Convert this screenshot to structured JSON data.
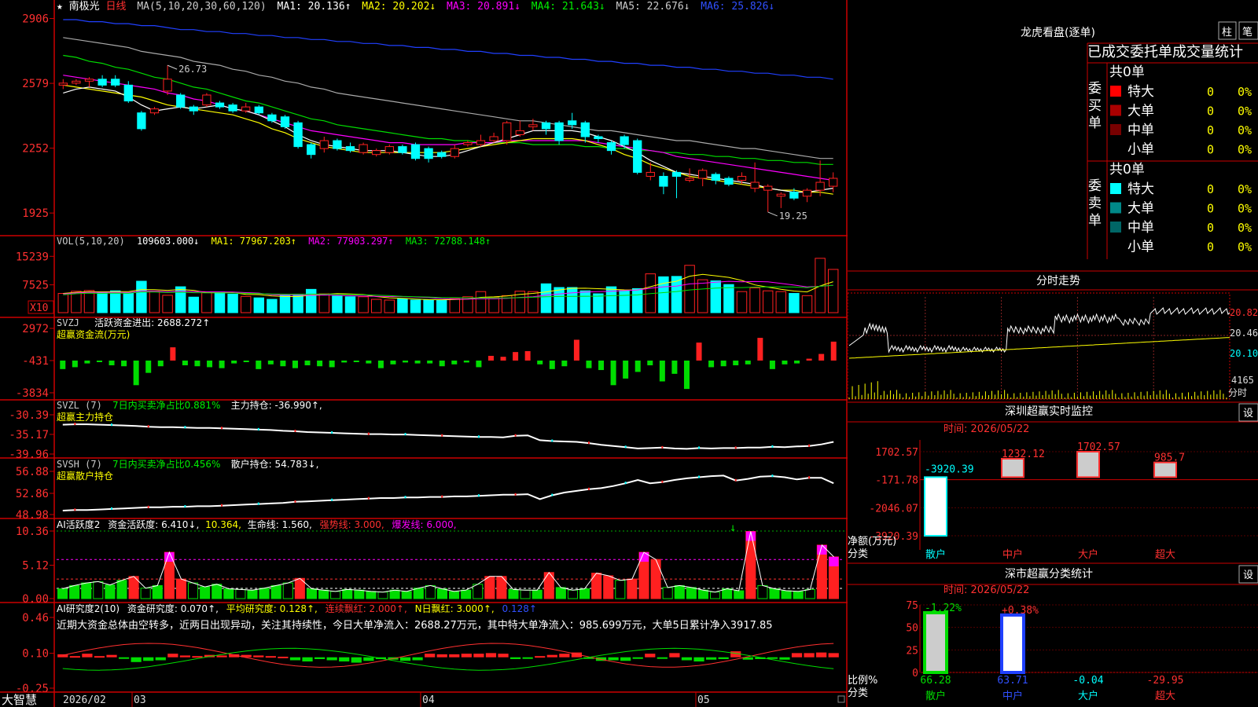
{
  "colors": {
    "up": "#ff2020",
    "down": "#00ffff",
    "ma1": "#ffffff",
    "ma2": "#ffff00",
    "ma3": "#ff00ff",
    "ma4": "#00dd00",
    "ma5": "#aaaaaa",
    "ma6": "#2040ff",
    "axis": "#cc0000"
  },
  "main": {
    "star": "★",
    "name": "南极光",
    "period": "日线",
    "ma_text": "MA(5,10,20,30,60,120)",
    "ma1": "MA1: 20.136↑",
    "ma2": "MA2: 20.202↓",
    "ma3": "MA3: 20.891↓",
    "ma4": "MA4: 21.643↓",
    "ma5": "MA5: 22.676↓",
    "ma6": "MA6: 25.826↓",
    "high_label": "26.73",
    "low_label": "19.25",
    "y_labels": [
      "2906",
      "2579",
      "2252",
      "1925"
    ]
  },
  "vol": {
    "header": "VOL(5,10,20)",
    "value": "109603.000↓",
    "ma1": "MA1: 77967.203↑",
    "ma2": "MA2: 77903.297↑",
    "ma3": "MA3: 72788.148↑",
    "y_labels": [
      "15239",
      "7525"
    ],
    "unit": "X10"
  },
  "svzj": {
    "header": "SVZJ",
    "title": "活跃资金进出: 2688.272↑",
    "sub": "超赢资金流(万元)",
    "y_labels": [
      "2972",
      "-431",
      "-3834"
    ]
  },
  "svzl": {
    "header": "SVZL (7)",
    "green": "7日内买卖净占比0.881%",
    "white": "主力持仓: -36.990↑,",
    "sub": "超赢主力持仓",
    "y_labels": [
      "-30.39",
      "-35.17",
      "-39.96"
    ]
  },
  "svsh": {
    "header": "SVSH (7)",
    "green": "7日内买卖净占比0.456%",
    "white": "散户持仓: 54.783↓,",
    "sub": "超赢散户持仓",
    "y_labels": [
      "56.88",
      "52.86",
      "48.98"
    ]
  },
  "ai2": {
    "t1": "AI活跃度2",
    "t2": "资金活跃度: 6.410↓,",
    "t3": "10.364,",
    "t4": "生命线: 1.560,",
    "t5": "强势线: 3.000,",
    "t6": "爆发线: 6.000,",
    "y_labels": [
      "10.36",
      "5.12",
      "0.00"
    ]
  },
  "ai3": {
    "t1": "AI研究度2(10)",
    "t2": "资金研究度: 0.070↑,",
    "t3": "平均研究度: 0.128↑,",
    "t4": "连续飘红: 2.000↑,",
    "t5": "N日飘红: 3.000↑,",
    "t6": "0.128↑",
    "commentary": "近期大资金总体由空转多，近两日出现异动，关注其持续性，今日大单净流入：2688.27万元，其中特大单净流入：985.699万元，大单5日累计净入3917.85",
    "y_labels": [
      "0.46",
      "0.10",
      "-0.25"
    ]
  },
  "timeaxis": {
    "brand": "大智慧",
    "labels": [
      "2026/02",
      "03",
      "04",
      "05"
    ]
  },
  "lhb": {
    "title": "龙虎看盘(逐单)",
    "btn_zhu": "柱",
    "btn_bi": "笔",
    "stat_title": "已成交委托单成交量统计",
    "buy_label": "委买单",
    "sell_label": "委卖单",
    "buy_total": "共0单",
    "sell_total": "共0单",
    "rows": [
      "特大",
      "大单",
      "中单",
      "小单"
    ],
    "zero": "0",
    "pct": "0%"
  },
  "fenshi": {
    "title": "分时走势",
    "prices": [
      "20.82",
      "20.46",
      "20.10"
    ],
    "vol": "4165",
    "unit": "分时"
  },
  "sz_monitor": {
    "title": "深圳超赢实时监控",
    "btn": "设",
    "time": "时间: 2026/05/22",
    "y_labels": [
      "1702.57",
      "-171.78",
      "-2046.07",
      "-3920.39"
    ],
    "ylabel1": "净额(万元)",
    "ylabel2": "分类",
    "cats": [
      "散户",
      "中户",
      "大户",
      "超大"
    ],
    "bar_labels": [
      "-3920.39",
      "1232.12",
      "1702.57",
      "985.7"
    ]
  },
  "sz_class": {
    "title": "深市超赢分类统计",
    "btn": "设",
    "time": "时间: 2026/05/22",
    "y_labels": [
      "75",
      "50",
      "25",
      "0"
    ],
    "ylabel1": "比例%",
    "ylabel2": "分类",
    "top_labels": [
      "-1.22%",
      "+0.38%"
    ],
    "bottom_labels": [
      "66.28",
      "63.71",
      "-0.04",
      "-29.95"
    ],
    "cats": [
      "散户",
      "中户",
      "大户",
      "超大"
    ]
  },
  "chart_data": [
    {
      "type": "candlestick",
      "title": "南极光 日线",
      "y_range": [
        19.0,
        29.06
      ],
      "o": [
        25.7,
        25.8,
        25.9,
        26.0,
        26.0,
        25.7,
        24.3,
        24.3,
        25.4,
        25.2,
        24.6,
        24.7,
        24.8,
        24.7,
        24.4,
        24.6,
        24.2,
        24.1,
        23.8,
        22.7,
        22.5,
        22.9,
        22.6,
        22.3,
        22.2,
        22.3,
        22.6,
        22.7,
        22.5,
        22.3,
        22.1,
        22.7,
        22.7,
        22.9,
        22.9,
        23.2,
        23.6,
        23.8,
        23.8,
        23.9,
        23.8,
        23.1,
        22.8,
        23.1,
        22.9,
        21.1,
        21.1,
        21.3,
        20.9,
        21.0,
        21.2,
        21.0,
        20.9,
        20.5,
        20.4,
        20.1,
        20.3,
        20.1,
        20.4,
        20.6
      ],
      "c": [
        25.8,
        25.9,
        26.0,
        25.7,
        25.7,
        24.9,
        23.5,
        24.5,
        26.0,
        24.6,
        24.4,
        25.2,
        24.6,
        24.4,
        24.6,
        24.3,
        23.9,
        23.6,
        22.6,
        22.2,
        22.9,
        22.5,
        22.4,
        22.7,
        22.4,
        22.6,
        22.3,
        22.0,
        22.0,
        22.1,
        22.5,
        22.8,
        22.9,
        23.1,
        23.8,
        23.4,
        23.7,
        23.5,
        22.9,
        23.7,
        23.1,
        23.0,
        22.4,
        22.7,
        21.3,
        21.3,
        20.6,
        21.1,
        21.0,
        21.4,
        20.9,
        20.7,
        21.1,
        20.8,
        20.6,
        20.2,
        20.0,
        20.4,
        20.8,
        21.0
      ],
      "h": [
        26.0,
        26.0,
        26.1,
        26.2,
        26.2,
        25.9,
        24.4,
        24.6,
        26.7,
        25.3,
        24.7,
        25.3,
        24.9,
        24.8,
        24.8,
        24.7,
        24.3,
        24.2,
        23.9,
        22.8,
        23.1,
        23.0,
        22.8,
        22.8,
        22.5,
        22.7,
        22.7,
        22.8,
        22.6,
        22.4,
        22.7,
        22.9,
        23.2,
        23.3,
        23.9,
        23.9,
        24.0,
        23.9,
        23.9,
        24.3,
        23.9,
        23.2,
        22.9,
        23.2,
        23.0,
        21.8,
        21.3,
        21.4,
        21.5,
        21.5,
        21.3,
        21.1,
        21.3,
        21.8,
        20.7,
        20.3,
        20.5,
        20.5,
        21.9,
        21.3
      ],
      "l": [
        25.5,
        25.7,
        25.6,
        25.6,
        25.6,
        24.8,
        23.4,
        24.2,
        25.2,
        24.5,
        24.2,
        24.6,
        24.5,
        24.3,
        24.3,
        24.2,
        23.8,
        23.5,
        22.5,
        22.0,
        22.3,
        22.4,
        22.3,
        22.2,
        22.1,
        22.2,
        22.2,
        21.9,
        21.8,
        22.0,
        22.0,
        22.6,
        22.6,
        22.8,
        22.7,
        23.1,
        23.4,
        23.2,
        22.7,
        23.5,
        22.8,
        22.8,
        22.2,
        22.5,
        21.2,
        20.9,
        20.2,
        20.0,
        20.8,
        20.6,
        20.7,
        20.6,
        20.7,
        20.3,
        19.3,
        19.5,
        19.9,
        19.8,
        20.1,
        20.3
      ],
      "ma5": [
        25.3,
        25.5,
        25.6,
        25.5,
        25.4,
        25.1,
        24.7,
        24.4,
        24.5,
        24.6,
        24.5,
        24.6,
        24.7,
        24.5,
        24.4,
        24.2,
        23.9,
        23.6,
        23.2,
        22.9,
        22.7,
        22.6,
        22.5,
        22.4,
        22.4,
        22.4,
        22.3,
        22.2,
        22.1,
        22.1,
        22.2,
        22.4,
        22.6,
        22.8,
        23.0,
        23.2,
        23.4,
        23.4,
        23.4,
        23.4,
        23.3,
        23.1,
        22.9,
        22.6,
        22.3,
        21.9,
        21.6,
        21.3,
        21.2,
        21.1,
        21.0,
        20.9,
        20.8,
        20.7,
        20.5,
        20.4,
        20.3,
        20.3,
        20.4,
        20.5
      ],
      "ma10": [
        25.7,
        25.6,
        25.5,
        25.4,
        25.3,
        25.2,
        25.1,
        24.9,
        24.7,
        24.6,
        24.5,
        24.4,
        24.3,
        24.2,
        24.0,
        23.8,
        23.5,
        23.3,
        23.0,
        22.8,
        22.6,
        22.5,
        22.4,
        22.3,
        22.3,
        22.3,
        22.3,
        22.3,
        22.3,
        22.3,
        22.4,
        22.5,
        22.6,
        22.7,
        22.8,
        22.9,
        23.0,
        23.0,
        23.0,
        23.0,
        22.9,
        22.7,
        22.5,
        22.2,
        22.0,
        21.7,
        21.5,
        21.3,
        21.1,
        21.0,
        20.9,
        20.8,
        20.7,
        20.6,
        20.5,
        20.4,
        20.4,
        20.3,
        20.3,
        20.2
      ],
      "ma20": [
        26.2,
        26.1,
        26.0,
        25.9,
        25.8,
        25.7,
        25.6,
        25.5,
        25.3,
        25.2,
        25.0,
        24.9,
        24.7,
        24.5,
        24.4,
        24.2,
        24.0,
        23.8,
        23.6,
        23.4,
        23.3,
        23.2,
        23.1,
        23.0,
        22.9,
        22.8,
        22.8,
        22.7,
        22.7,
        22.7,
        22.7,
        22.8,
        22.8,
        22.8,
        22.9,
        22.9,
        22.9,
        22.9,
        22.9,
        22.9,
        22.9,
        22.8,
        22.7,
        22.6,
        22.5,
        22.4,
        22.3,
        22.1,
        22.0,
        21.9,
        21.8,
        21.7,
        21.6,
        21.5,
        21.4,
        21.3,
        21.2,
        21.1,
        21.0,
        20.9
      ],
      "ma30": [
        27.2,
        27.1,
        26.9,
        26.8,
        26.6,
        26.5,
        26.3,
        26.1,
        26.0,
        25.8,
        25.6,
        25.5,
        25.3,
        25.1,
        24.9,
        24.8,
        24.6,
        24.4,
        24.2,
        24.0,
        23.9,
        23.7,
        23.6,
        23.5,
        23.4,
        23.3,
        23.2,
        23.1,
        23.0,
        23.0,
        22.9,
        22.9,
        22.8,
        22.8,
        22.8,
        22.8,
        22.7,
        22.7,
        22.7,
        22.7,
        22.6,
        22.6,
        22.5,
        22.5,
        22.4,
        22.4,
        22.3,
        22.3,
        22.2,
        22.2,
        22.1,
        22.1,
        22.0,
        22.0,
        21.9,
        21.9,
        21.8,
        21.8,
        21.7,
        21.7
      ],
      "ma60": [
        28.1,
        28.0,
        27.9,
        27.8,
        27.7,
        27.6,
        27.4,
        27.3,
        27.2,
        27.1,
        26.9,
        26.8,
        26.7,
        26.5,
        26.4,
        26.2,
        26.1,
        25.9,
        25.8,
        25.6,
        25.5,
        25.3,
        25.2,
        25.1,
        25.0,
        24.9,
        24.8,
        24.7,
        24.6,
        24.5,
        24.4,
        24.3,
        24.2,
        24.1,
        24.0,
        23.9,
        23.9,
        23.8,
        23.7,
        23.6,
        23.5,
        23.4,
        23.4,
        23.3,
        23.2,
        23.1,
        23.0,
        22.9,
        22.9,
        22.8,
        22.7,
        22.6,
        22.5,
        22.5,
        22.4,
        22.3,
        22.2,
        22.1,
        22.0,
        22.0
      ],
      "ma120": [
        29.0,
        29.0,
        28.9,
        28.9,
        28.8,
        28.8,
        28.7,
        28.7,
        28.6,
        28.5,
        28.5,
        28.4,
        28.4,
        28.3,
        28.3,
        28.2,
        28.2,
        28.1,
        28.1,
        28.0,
        28.0,
        27.9,
        27.9,
        27.8,
        27.8,
        27.7,
        27.7,
        27.6,
        27.6,
        27.5,
        27.5,
        27.4,
        27.4,
        27.3,
        27.3,
        27.2,
        27.2,
        27.1,
        27.1,
        27.0,
        27.0,
        26.9,
        26.9,
        26.8,
        26.8,
        26.7,
        26.7,
        26.6,
        26.6,
        26.5,
        26.5,
        26.4,
        26.4,
        26.3,
        26.3,
        26.2,
        26.2,
        26.1,
        26.1,
        26.0
      ]
    },
    {
      "type": "bar",
      "title": "VOL",
      "y_range": [
        0,
        17000
      ],
      "values": [
        5200,
        5800,
        6000,
        5500,
        5900,
        5300,
        8500,
        5800,
        4700,
        7000,
        4200,
        5400,
        5600,
        5000,
        4400,
        4000,
        3600,
        4800,
        5000,
        6300,
        5100,
        4500,
        4300,
        4300,
        3600,
        3400,
        3700,
        3400,
        3500,
        3400,
        3800,
        4300,
        5700,
        4200,
        4600,
        5800,
        5700,
        7800,
        6800,
        6800,
        5900,
        5100,
        7000,
        6000,
        6500,
        10500,
        9700,
        9800,
        12800,
        8900,
        8600,
        7600,
        5700,
        6700,
        5900,
        5700,
        5200,
        4600,
        14700,
        11700
      ]
    },
    {
      "type": "bar",
      "title": "超赢资金流(万元)",
      "y_range": [
        -3834,
        2972
      ],
      "values": [
        -900,
        -700,
        -300,
        -100,
        -500,
        -600,
        -2600,
        -1300,
        -600,
        1400,
        -500,
        -600,
        -700,
        -800,
        -300,
        -100,
        -900,
        -400,
        -600,
        -800,
        -500,
        -600,
        -700,
        -200,
        -100,
        -300,
        -800,
        -400,
        -200,
        -300,
        -300,
        -600,
        -400,
        -200,
        -700,
        500,
        400,
        900,
        1000,
        -400,
        -900,
        -600,
        2200,
        -800,
        -1000,
        -2600,
        -1900,
        -1200,
        -500,
        -2200,
        -1400,
        -3000,
        1900,
        -700,
        -600,
        -500,
        -400,
        2400,
        -900,
        -400,
        -300,
        200,
        700,
        2000
      ],
      "note": "daily fund flow bars (approximate)"
    },
    {
      "type": "line",
      "title": "超赢主力持仓",
      "y_range": [
        -39.96,
        -30.39
      ],
      "values": [
        -32.8,
        -32.7,
        -32.7,
        -32.8,
        -32.9,
        -33.0,
        -33.1,
        -33.3,
        -33.4,
        -33.4,
        -33.5,
        -33.6,
        -33.6,
        -33.7,
        -33.8,
        -33.9,
        -34.0,
        -34.1,
        -34.3,
        -34.4,
        -34.6,
        -34.7,
        -34.8,
        -34.9,
        -35.0,
        -35.1,
        -35.1,
        -35.2,
        -35.2,
        -35.3,
        -35.4,
        -35.5,
        -35.6,
        -35.7,
        -35.8,
        -35.8,
        -35.9,
        -35.5,
        -35.4,
        -36.6,
        -36.8,
        -36.9,
        -37.0,
        -37.3,
        -37.7,
        -38.0,
        -38.3,
        -38.6,
        -38.5,
        -38.4,
        -38.6,
        -38.7,
        -38.5,
        -38.6,
        -38.5,
        -38.5,
        -38.4,
        -38.4,
        -38.2,
        -38.3,
        -38.1,
        -38.0,
        -37.6,
        -37.0
      ]
    },
    {
      "type": "line",
      "title": "超赢散户持仓",
      "y_range": [
        48.98,
        56.88
      ],
      "values": [
        49.7,
        49.8,
        49.8,
        49.9,
        50.0,
        50.1,
        50.2,
        50.3,
        50.3,
        50.4,
        50.4,
        50.5,
        50.5,
        50.6,
        50.7,
        50.8,
        50.9,
        51.0,
        51.1,
        51.3,
        51.4,
        51.5,
        51.6,
        51.7,
        51.8,
        51.9,
        52.0,
        52.0,
        52.1,
        52.1,
        52.2,
        52.2,
        52.3,
        52.3,
        52.4,
        52.5,
        52.6,
        52.6,
        52.7,
        51.8,
        52.5,
        53.0,
        53.3,
        53.6,
        53.8,
        54.2,
        54.7,
        55.3,
        54.7,
        54.9,
        55.3,
        55.6,
        55.8,
        56.0,
        56.1,
        55.2,
        55.5,
        55.9,
        56.0,
        55.8,
        55.4,
        55.7,
        55.7,
        54.7
      ]
    },
    {
      "type": "bar",
      "title": "AI活跃度2",
      "y_range": [
        0,
        10.36
      ],
      "values": [
        1.5,
        2.0,
        2.4,
        2.6,
        2.1,
        2.8,
        3.4,
        1.6,
        2.0,
        7.1,
        3.0,
        2.4,
        1.8,
        2.2,
        1.5,
        1.4,
        1.3,
        1.6,
        2.0,
        2.4,
        3.1,
        1.5,
        1.3,
        1.1,
        1.4,
        1.3,
        1.1,
        1.0,
        1.3,
        1.1,
        1.6,
        2.0,
        1.5,
        1.1,
        1.3,
        2.2,
        3.4,
        3.4,
        1.4,
        1.3,
        1.3,
        4.0,
        1.7,
        1.3,
        1.5,
        3.9,
        3.5,
        2.8,
        3.0,
        7.1,
        6.0,
        1.7,
        2.0,
        1.7,
        1.3,
        1.0,
        1.5,
        1.2,
        10.3,
        2.0,
        1.5,
        1.2,
        1.1,
        1.4,
        8.2,
        6.4
      ],
      "life_line": 1.56,
      "strong_line": 3.0,
      "burst_line": 6.0
    },
    {
      "type": "bar",
      "title": "AI研究度2(10)",
      "y_range": [
        -0.25,
        0.46
      ],
      "values": [
        0.05,
        0.02,
        0.06,
        0.02,
        0.04,
        -0.02,
        -0.08,
        -0.06,
        -0.05,
        0.06,
        0.03,
        0.02,
        0.04,
        0.03,
        0.05,
        0.04,
        0.03,
        0.02,
        0.01,
        -0.05,
        -0.07,
        -0.03,
        -0.05,
        -0.07,
        -0.09,
        -0.06,
        -0.03,
        -0.04,
        -0.06,
        -0.05,
        0.06,
        0.05,
        0.05,
        0.06,
        0.06,
        0.07,
        0.06,
        -0.03,
        -0.02,
        0.02,
        0.04,
        0.06,
        0.08,
        -0.02,
        -0.06,
        -0.05,
        -0.06,
        -0.02,
        0.06,
        -0.01,
        0.07,
        -0.05,
        -0.07,
        -0.04,
        -0.03,
        0.1,
        -0.04,
        -0.03,
        -0.02,
        -0.04,
        0.07,
        0.07,
        0.08,
        0.07
      ],
      "avg_line": 0.128
    }
  ]
}
